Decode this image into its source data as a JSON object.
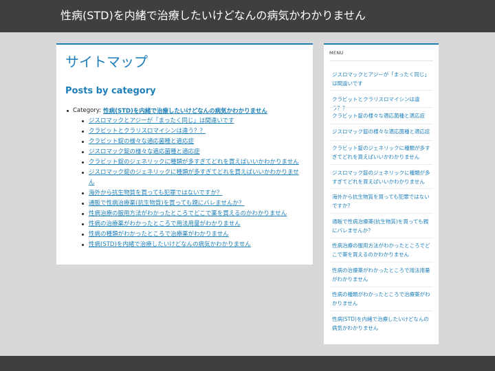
{
  "header": {
    "site_title": "性病(STD)を内緒で治療したいけどなんの病気かわかりません"
  },
  "main": {
    "page_title": "サイトマップ",
    "section_heading": "Posts by category",
    "category_prefix": "Category:",
    "category_name": "性病(STD)を内緒で治療したいけどなんの病気かわかりません",
    "posts": [
      "ジスロマックとアジーが「まったく同じ」は間違いです",
      "クラビットとクラリスロマイシンは違う？？",
      "クラビット錠の様々な適応菌種と適応症",
      "ジスロマック錠の様々な適応菌種と適応症",
      "クラビット錠のジェネリックに種類が多すぎてどれを買えばいいかわかりません",
      "ジスロマック錠のジェネリックに種類が多すぎてどれを買えばいいかわかりません",
      "海外から抗生物質を買っても犯罪ではないですか？",
      "通販で性病治療薬(抗生物質)を買っても親にバレませんか？",
      "性病治療の服用方法がわかったところでどこで薬を買えるのかわかりません",
      "性病の治療薬がわかったところで用法用量がわかりません",
      "性病の種類がわかったところで治療薬がわかりません",
      "性病(STD)を内緒で治療したいけどなんの病気かわかりません"
    ]
  },
  "sidebar": {
    "widget_title": "MENU",
    "items": [
      "ジスロマックとアジーが「まったく同じ」は間違いです",
      "クラビットとクラリスロマイシンは違う？？",
      "クラビット錠の様々な適応菌種と適応症",
      "ジスロマック錠の様々な適応菌種と適応症",
      "クラビット錠のジェネリックに種類が多すぎてどれを買えばいいかわかりません",
      "ジスロマック錠のジェネリックに種類が多すぎてどれを買えばいいかわかりません",
      "海外から抗生物質を買っても犯罪ではないですか？",
      "通販で性病治療薬(抗生物質)を買っても親にバレませんか？",
      "性病治療の服用方法がわかったところでどこで薬を買えるのかわかりません",
      "性病の治療薬がわかったところで用法用量がわかりません",
      "性病の種類がわかったところで治療薬がわかりません",
      "性病(STD)を内緒で治療したいけどなんの病気かわかりません"
    ]
  },
  "colors": {
    "header_bg": "#3f3f3f",
    "page_bg": "#d8d8d8",
    "link": "#1e7fb8",
    "panel_bg": "#ffffff"
  }
}
